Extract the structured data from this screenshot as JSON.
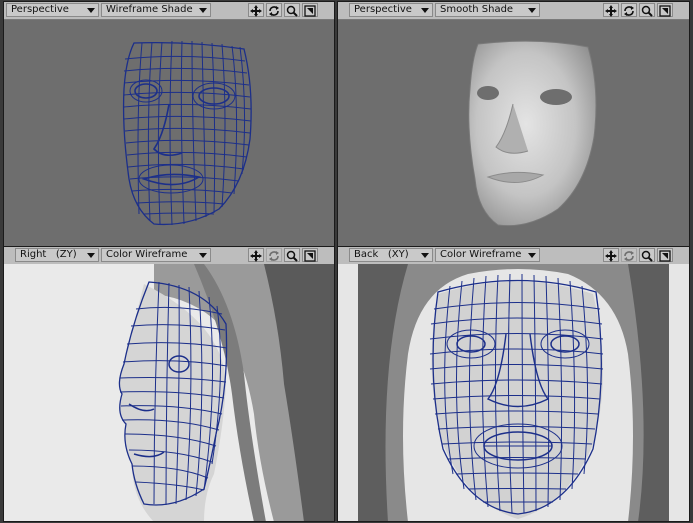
{
  "viewports": [
    {
      "id": "vp1",
      "view": "Perspective",
      "mode": "Wireframe Shade"
    },
    {
      "id": "vp2",
      "view": "Perspective",
      "mode": "Smooth Shade"
    },
    {
      "id": "vp3",
      "view": "Right",
      "axis": "(ZY)",
      "mode": "Color Wireframe"
    },
    {
      "id": "vp4",
      "view": "Back",
      "axis": "(XY)",
      "mode": "Color Wireframe"
    }
  ],
  "icons": [
    "move-icon",
    "rotate-icon",
    "zoom-icon",
    "maximize-icon"
  ],
  "colors": {
    "wire": "#1c2f8a",
    "viewport_bg": "#6e6e6e",
    "toolbar": "#bdbdbd"
  }
}
